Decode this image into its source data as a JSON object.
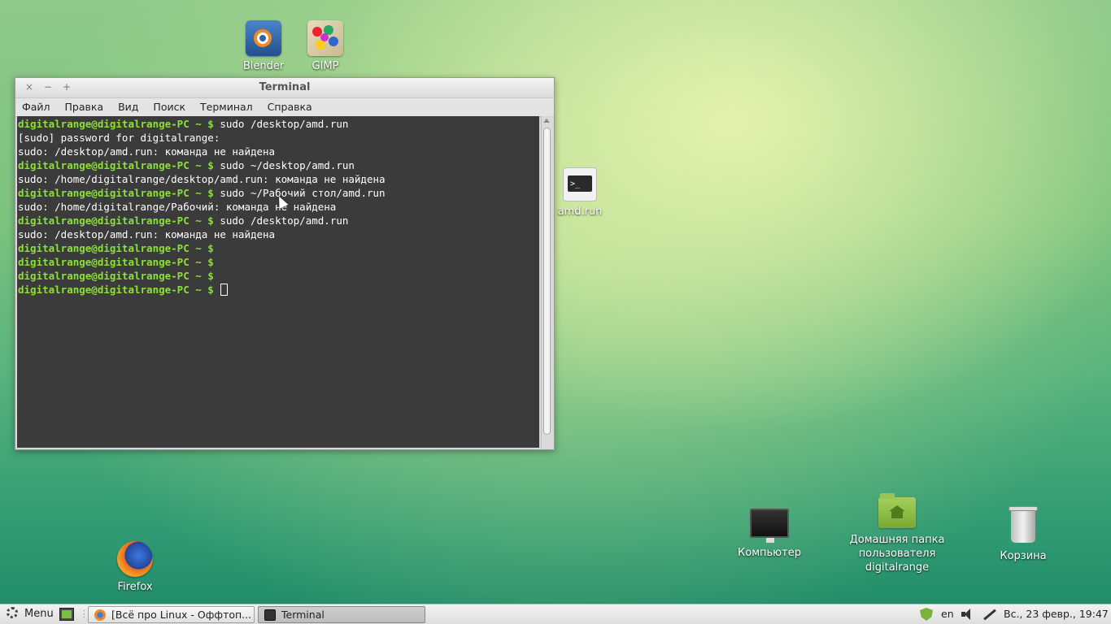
{
  "desktop": {
    "icons": [
      {
        "label": "Blender"
      },
      {
        "label": "GIMP"
      },
      {
        "label": "amd.run"
      },
      {
        "label": "Firefox"
      },
      {
        "label": "Компьютер"
      },
      {
        "label": "Домашняя папка пользователя digitalrange"
      },
      {
        "label": "Корзина"
      }
    ]
  },
  "terminal_window": {
    "title": "Terminal",
    "controls": {
      "close": "×",
      "minimize": "−",
      "maximize": "+"
    },
    "menu": [
      "Файл",
      "Правка",
      "Вид",
      "Поиск",
      "Терминал",
      "Справка"
    ],
    "prompt": "digitalrange@digitalrange-PC ~ $",
    "lines": [
      {
        "prompt": "digitalrange@digitalrange-PC ~ $",
        "text": " sudo /desktop/amd.run"
      },
      {
        "prompt": "",
        "text": "[sudo] password for digitalrange:"
      },
      {
        "prompt": "",
        "text": "sudo: /desktop/amd.run: команда не найдена"
      },
      {
        "prompt": "digitalrange@digitalrange-PC ~ $",
        "text": " sudo ~/desktop/amd.run"
      },
      {
        "prompt": "",
        "text": "sudo: /home/digitalrange/desktop/amd.run: команда не найдена"
      },
      {
        "prompt": "digitalrange@digitalrange-PC ~ $",
        "text": " sudo ~/Рабочий стол/amd.run"
      },
      {
        "prompt": "",
        "text": "sudo: /home/digitalrange/Рабочий: команда не найдена"
      },
      {
        "prompt": "digitalrange@digitalrange-PC ~ $",
        "text": " sudo /desktop/amd.run"
      },
      {
        "prompt": "",
        "text": "sudo: /desktop/amd.run: команда не найдена"
      },
      {
        "prompt": "digitalrange@digitalrange-PC ~ $",
        "text": ""
      },
      {
        "prompt": "digitalrange@digitalrange-PC ~ $",
        "text": ""
      },
      {
        "prompt": "digitalrange@digitalrange-PC ~ $",
        "text": ""
      },
      {
        "prompt": "digitalrange@digitalrange-PC ~ $",
        "text": " "
      }
    ]
  },
  "taskbar": {
    "menu_label": "Menu",
    "tasks": [
      {
        "label": "[Всё про Linux - Оффтоп...",
        "icon": "firefox-icon"
      },
      {
        "label": "Terminal",
        "icon": "terminal-icon"
      }
    ],
    "tray": {
      "language": "en",
      "clock": "Вс., 23 февр., 19:47"
    }
  },
  "colors": {
    "prompt": "#8ae234",
    "terminal_bg": "#3b3b3b",
    "wallpaper_green": "#58b37d"
  }
}
